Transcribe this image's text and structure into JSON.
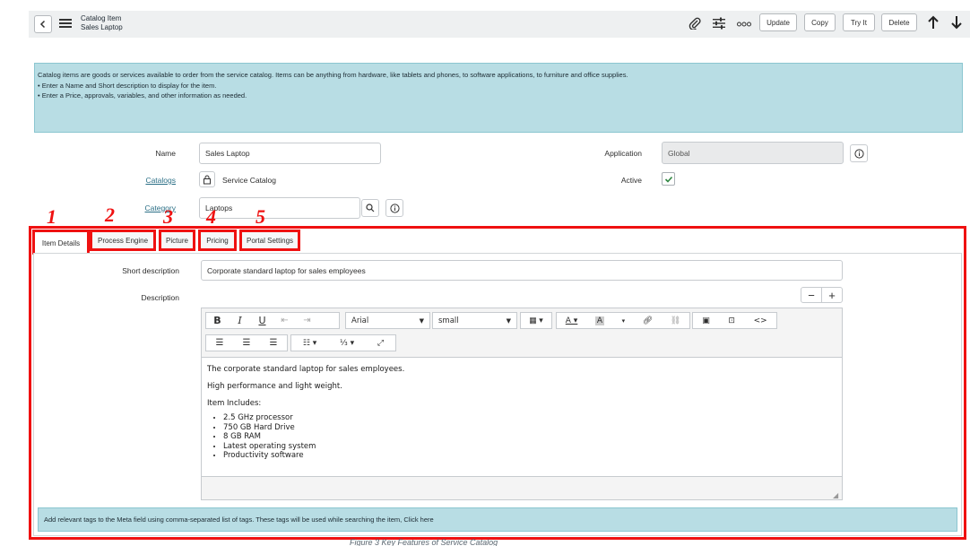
{
  "header": {
    "record_type": "Catalog Item",
    "record_name": "Sales Laptop",
    "buttons": [
      "Update",
      "Copy",
      "Try It",
      "Delete"
    ],
    "icons": [
      "back-icon",
      "menu-icon",
      "attachment-icon",
      "settings-sliders-icon",
      "more-icon",
      "arrow-up-icon",
      "arrow-down-icon"
    ]
  },
  "info": {
    "line1": "Catalog items are goods or services available to order from the service catalog. Items can be anything from hardware, like tablets and phones, to software applications, to furniture and office supplies.",
    "bullet1": "Enter a Name and Short description to display for the item.",
    "bullet2": "Enter a Price, approvals, variables, and other information as needed."
  },
  "form": {
    "name_label": "Name",
    "name_value": "Sales Laptop",
    "catalogs_label": "Catalogs",
    "catalogs_value": "Service Catalog",
    "category_label": "Category",
    "category_value": "Laptops",
    "application_label": "Application",
    "application_value": "Global",
    "active_label": "Active",
    "active_checked": true
  },
  "annotations": [
    "1",
    "2",
    "3",
    "4",
    "5"
  ],
  "tabs": [
    "Item Details",
    "Process Engine",
    "Picture",
    "Pricing",
    "Portal Settings"
  ],
  "details": {
    "short_desc_label": "Short description",
    "short_desc_value": "Corporate standard laptop for sales employees",
    "description_label": "Description",
    "font_name": "Arial",
    "font_size": "small",
    "editor_lines": [
      "The corporate standard laptop for sales employees.",
      "High performance and light weight.",
      "Item Includes:"
    ],
    "editor_items": [
      "2.5 GHz processor",
      "750 GB Hard Drive",
      "8 GB RAM",
      "Latest operating system",
      "Productivity software"
    ],
    "meta_hint": "Add relevant tags to the Meta field using comma-separated list of tags. These tags will be used while searching the item, Click here"
  },
  "caption": "Figure 3 Key Features of Service Catalog",
  "colors": {
    "accent": "#2b6f86",
    "info_bg": "#b8dde4",
    "annotation_red": "#ef1111",
    "checkbox_green": "#2e8540"
  }
}
